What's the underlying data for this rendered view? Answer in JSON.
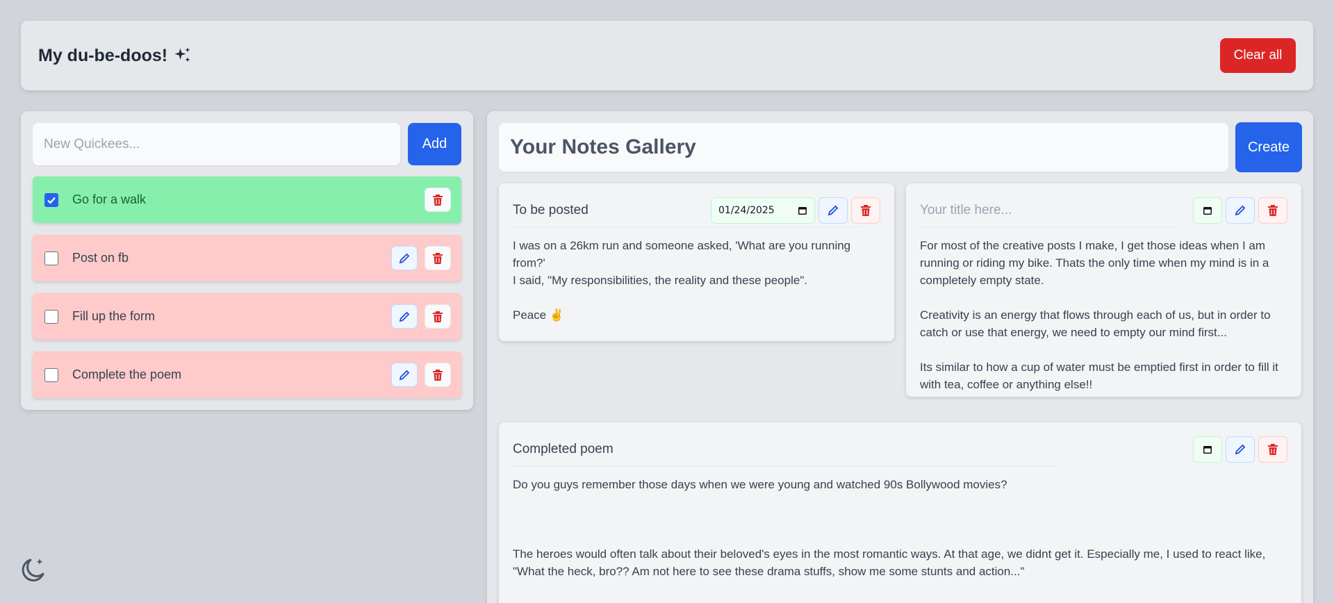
{
  "header": {
    "title": "My du-be-doos!",
    "clear_label": "Clear all"
  },
  "todo": {
    "placeholder": "New Quickees...",
    "add_label": "Add",
    "items": [
      {
        "label": "Go for a walk",
        "done": true
      },
      {
        "label": "Post on fb",
        "done": false
      },
      {
        "label": "Fill up the form",
        "done": false
      },
      {
        "label": "Complete the poem",
        "done": false
      }
    ]
  },
  "notes": {
    "gallery_title": "Your Notes Gallery",
    "create_label": "Create",
    "items": [
      {
        "title": "To be posted",
        "date": "01/24/2025",
        "body": "I was on a 26km run and someone asked, 'What are you running from?'\nI said, \"My responsibilities, the reality and these people\".\n\nPeace ✌️"
      },
      {
        "title_placeholder": "Your title here...",
        "body": "For most of the creative posts I make, I get those ideas when I am running or riding my bike. Thats the only time when my mind is in a completely empty state.\n\nCreativity is an energy that flows through each of us, but in order to catch or use that energy, we need to empty our mind first...\n\nIts similar to how a cup of water must be emptied first in order to fill it with tea, coffee or anything else!!"
      },
      {
        "title": "Completed poem",
        "body": "Do you guys remember those days when we were young and watched 90s Bollywood movies?\n\n\n\nThe heroes would often talk about their beloved's eyes in the most romantic ways. At that age, we didnt get it. Especially me, I used to react like, \"What the heck, bro?? Am not here to see these drama stuffs, show me some stunts and action...\""
      }
    ]
  },
  "colors": {
    "primary": "#2563eb",
    "danger": "#dc2626",
    "done_bg": "#86efac",
    "pending_bg": "#fecaca"
  }
}
